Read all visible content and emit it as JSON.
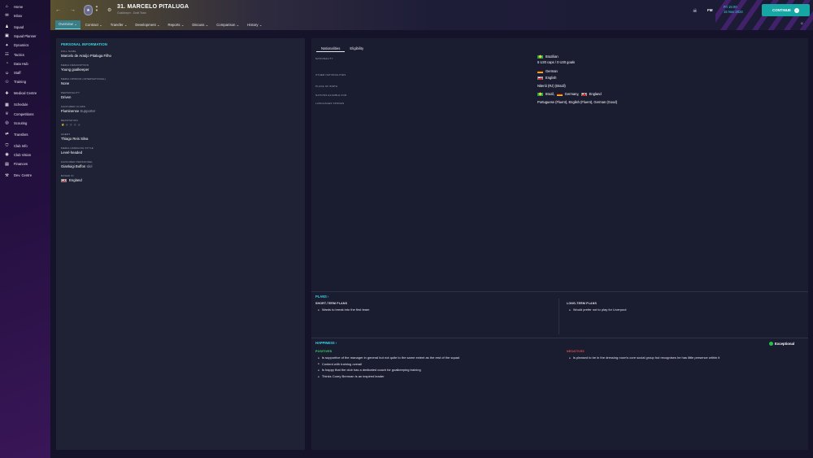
{
  "sidebar": {
    "items": [
      {
        "label": "Home",
        "icon": "home-icon",
        "glyph": "⌂"
      },
      {
        "label": "Inbox",
        "icon": "inbox-icon",
        "glyph": "✉"
      },
      {
        "label": "Squad",
        "icon": "squad-icon",
        "glyph": "♟"
      },
      {
        "label": "Squad Planner",
        "icon": "planner-icon",
        "glyph": "▣"
      },
      {
        "label": "Dynamics",
        "icon": "dynamics-icon",
        "glyph": "✦"
      },
      {
        "label": "Tactics",
        "icon": "tactics-icon",
        "glyph": "☷"
      },
      {
        "label": "Data Hub",
        "icon": "datahub-icon",
        "glyph": "◔"
      },
      {
        "label": "Staff",
        "icon": "staff-icon",
        "glyph": "☺"
      },
      {
        "label": "Training",
        "icon": "training-icon",
        "glyph": "☉"
      },
      {
        "label": "Medical Centre",
        "icon": "medical-icon",
        "glyph": "✚"
      },
      {
        "label": "Schedule",
        "icon": "schedule-icon",
        "glyph": "▦"
      },
      {
        "label": "Competitions",
        "icon": "trophy-icon",
        "glyph": "♕"
      },
      {
        "label": "Scouting",
        "icon": "scouting-icon",
        "glyph": "◎"
      },
      {
        "label": "Transfers",
        "icon": "transfers-icon",
        "glyph": "⇄"
      },
      {
        "label": "Club Info",
        "icon": "shield-icon",
        "glyph": "⛉"
      },
      {
        "label": "Club Vision",
        "icon": "vision-icon",
        "glyph": "◉"
      },
      {
        "label": "Finances",
        "icon": "finances-icon",
        "glyph": "▤"
      },
      {
        "label": "Dev. Centre",
        "icon": "dev-centre-icon",
        "glyph": "⚒"
      }
    ]
  },
  "header": {
    "title": "31. MARCELO PITALUGA",
    "subtitle": "Goalkeeper - Draft Team",
    "badge": "★",
    "tabs": [
      {
        "label": "Overview ⌄",
        "active": true
      },
      {
        "label": "Contract ⌄",
        "active": false
      },
      {
        "label": "Transfer ⌄",
        "active": false
      },
      {
        "label": "Development ⌄",
        "active": false
      },
      {
        "label": "Reports ⌄",
        "active": false
      },
      {
        "label": "Discuss ⌄",
        "active": false
      },
      {
        "label": "Comparison ⌄",
        "active": false
      },
      {
        "label": "History ⌄",
        "active": false
      }
    ],
    "fm_label": "FM",
    "time": "Fri 15:00",
    "date": "15 Nov 2024",
    "continue_label": "CONTINUE",
    "skull_glyph": "☠",
    "bell_glyph": "☼"
  },
  "personal": {
    "section_title": "PERSONAL INFORMATION",
    "fields": {
      "full_name": {
        "label": "FULL NAME",
        "value": "Marcelo de Araújo Pitaluga Filho"
      },
      "media_description": {
        "label": "MEDIA DESCRIPTION",
        "value": "Young goalkeeper"
      },
      "media_opinion": {
        "label": "MEDIA OPINION (INTERNATIONAL)",
        "value": "None"
      },
      "personality": {
        "label": "PERSONALITY",
        "value": "Driven"
      },
      "favoured_clubs": {
        "label": "FAVOURED CLUBS",
        "value": "Fluminense",
        "extra": "Supporter"
      },
      "reputation": {
        "label": "REPUTATION",
        "value": 1,
        "max": 5
      },
      "agent": {
        "label": "AGENT",
        "value": "Thiago Reis Silva"
      },
      "media_handling": {
        "label": "MEDIA HANDLING STYLE",
        "value": "Level-headed"
      },
      "favoured_personnel": {
        "label": "FAVOURED PERSONNEL",
        "value": "Gianluigi Buffon",
        "extra": "Idol"
      },
      "based_in": {
        "label": "BASED IN",
        "value": "England"
      }
    }
  },
  "nationalities": {
    "tabs": [
      "Nationalities",
      "Eligibility"
    ],
    "rows": {
      "nationality": {
        "label": "NATIONALITY",
        "value": "Brazilian",
        "caps": "5 U20 caps / 0 U20 goals"
      },
      "other": {
        "label": "OTHER NATIONALITIES",
        "values": [
          "German",
          "English"
        ]
      },
      "birthplace": {
        "label": "PLACE OF BIRTH",
        "value": "Niterói (RJ) (Brazil)"
      },
      "eligible": {
        "label": "NATIONS ELIGIBLE FOR",
        "values": [
          "Brazil,",
          "Germany,",
          "England"
        ]
      },
      "languages": {
        "label": "LANGUAGES SPOKEN",
        "value": "Portuguese (Fluent), English (Fluent), German (Good)"
      }
    }
  },
  "plans": {
    "title": "PLANS ›",
    "short_label": "SHORT-TERM PLANS",
    "short_items": [
      "Wants to break into the first team"
    ],
    "long_label": "LONG-TERM PLANS",
    "long_items": [
      "Would prefer not to play for Liverpool"
    ]
  },
  "happiness": {
    "title": "HAPPINESS ›",
    "status": "Exceptional",
    "positives_label": "POSITIVES",
    "positives": [
      "Is supportive of the manager in general but not quite to the same extent as the rest of the squad",
      "Content with training overall",
      "Is happy that the club has a dedicated coach for goalkeeping training",
      "Thinks Corey Brennan is an inspired leader"
    ],
    "negatives_label": "NEGATIVES",
    "negatives": [
      "Is pleased to be in the dressing room's core social group but recognises he has little presence within it"
    ]
  },
  "colors": {
    "accent": "#3dd6e8",
    "positive": "#3ddc6a",
    "negative": "#e84c4c",
    "continue": "#16a6a4",
    "star": "#f2c230"
  }
}
